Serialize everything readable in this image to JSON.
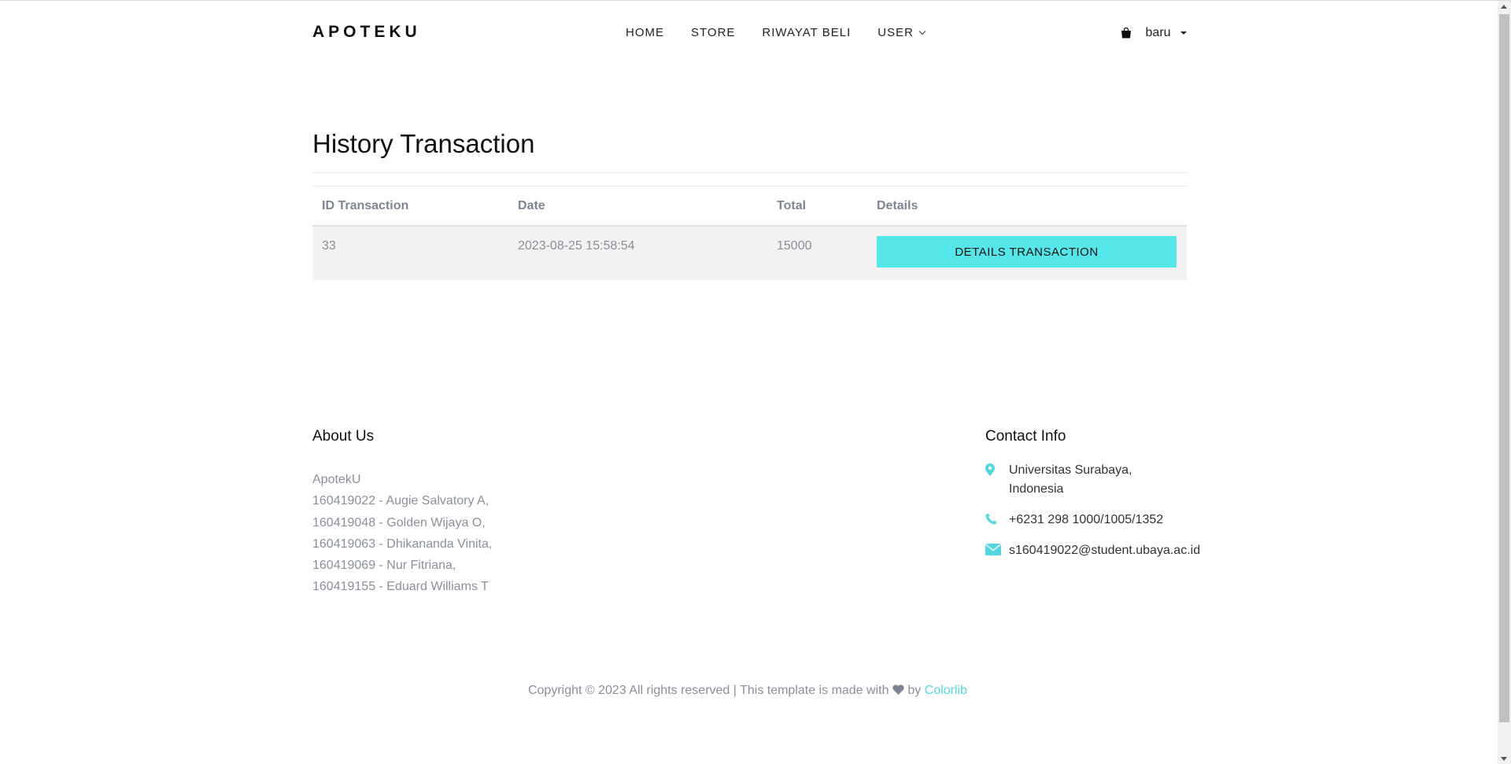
{
  "header": {
    "logo": "APOTEKU",
    "nav": [
      {
        "label": "HOME"
      },
      {
        "label": "STORE"
      },
      {
        "label": "RIWAYAT BELI"
      },
      {
        "label": "USER",
        "has_dropdown": true
      }
    ],
    "user_name": "baru",
    "cart_icon": "shopping-bag-icon"
  },
  "main": {
    "title": "History Transaction",
    "table": {
      "headers": [
        "ID Transaction",
        "Date",
        "Total",
        "Details"
      ],
      "rows": [
        {
          "id": "33",
          "date": "2023-08-25 15:58:54",
          "total": "15000",
          "button": "DETAILS TRANSACTION"
        }
      ]
    }
  },
  "footer": {
    "about": {
      "heading": "About Us",
      "lines": [
        "ApotekU",
        "160419022 - Augie Salvatory A,",
        "160419048 - Golden Wijaya O,",
        "160419063 - Dhikananda Vinita,",
        "160419069 - Nur Fitriana,",
        "160419155 - Eduard Williams T"
      ]
    },
    "contact": {
      "heading": "Contact Info",
      "address_line1": "Universitas Surabaya,",
      "address_line2": "Indonesia",
      "phone": "+6231 298 1000/1005/1352",
      "email": "s160419022@student.ubaya.ac.id",
      "icons": [
        "map-pin-icon",
        "phone-icon",
        "envelope-icon"
      ]
    },
    "copyright_prefix": "Copyright © 2023 All rights reserved | This template is made with",
    "copyright_by": "by",
    "copyright_link": "Colorlib"
  },
  "colors": {
    "accent": "#54e6e8",
    "muted_text": "#8a8f99",
    "row_bg": "#f2f2f2"
  }
}
